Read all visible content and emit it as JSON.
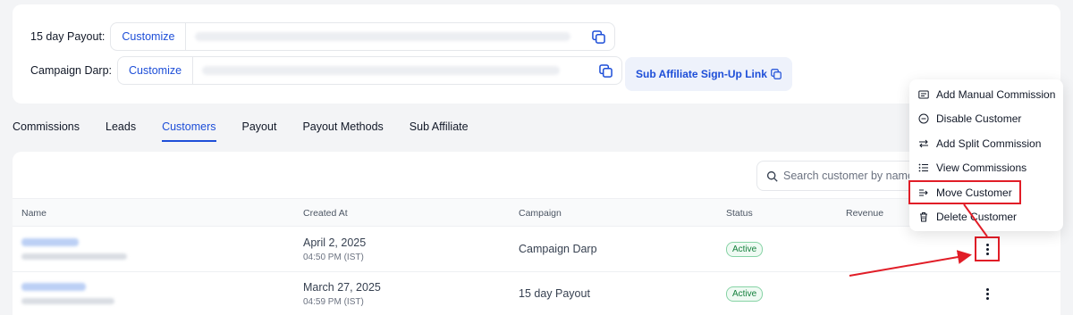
{
  "payout_links": [
    {
      "label": "15 day Payout:",
      "customize": "Customize"
    },
    {
      "label": "Campaign Darp:",
      "customize": "Customize"
    }
  ],
  "sub_affiliate_button": "Sub Affiliate Sign-Up Link",
  "tabs": [
    "Commissions",
    "Leads",
    "Customers",
    "Payout",
    "Payout Methods",
    "Sub Affiliate"
  ],
  "active_tab": "Customers",
  "search": {
    "placeholder": "Search customer by name"
  },
  "table": {
    "headers": {
      "name": "Name",
      "created": "Created At",
      "campaign": "Campaign",
      "status": "Status",
      "revenue": "Revenue"
    },
    "rows": [
      {
        "date": "April 2, 2025",
        "time": "04:50 PM (IST)",
        "campaign": "Campaign Darp",
        "status": "Active"
      },
      {
        "date": "March 27, 2025",
        "time": "04:59 PM (IST)",
        "campaign": "15 day Payout",
        "status": "Active"
      }
    ]
  },
  "menu": {
    "items": [
      {
        "label": "Add Manual Commission",
        "icon": "commission-icon"
      },
      {
        "label": "Disable Customer",
        "icon": "minus-circle-icon"
      },
      {
        "label": "Add Split Commission",
        "icon": "swap-arrows-icon"
      },
      {
        "label": "View Commissions",
        "icon": "list-icon"
      },
      {
        "label": "Move Customer",
        "icon": "move-arrow-icon"
      },
      {
        "label": "Delete Customer",
        "icon": "trash-icon"
      }
    ]
  },
  "colors": {
    "accent": "#1d4ed8",
    "highlight": "#e11d27",
    "active_badge": "#15803d"
  }
}
